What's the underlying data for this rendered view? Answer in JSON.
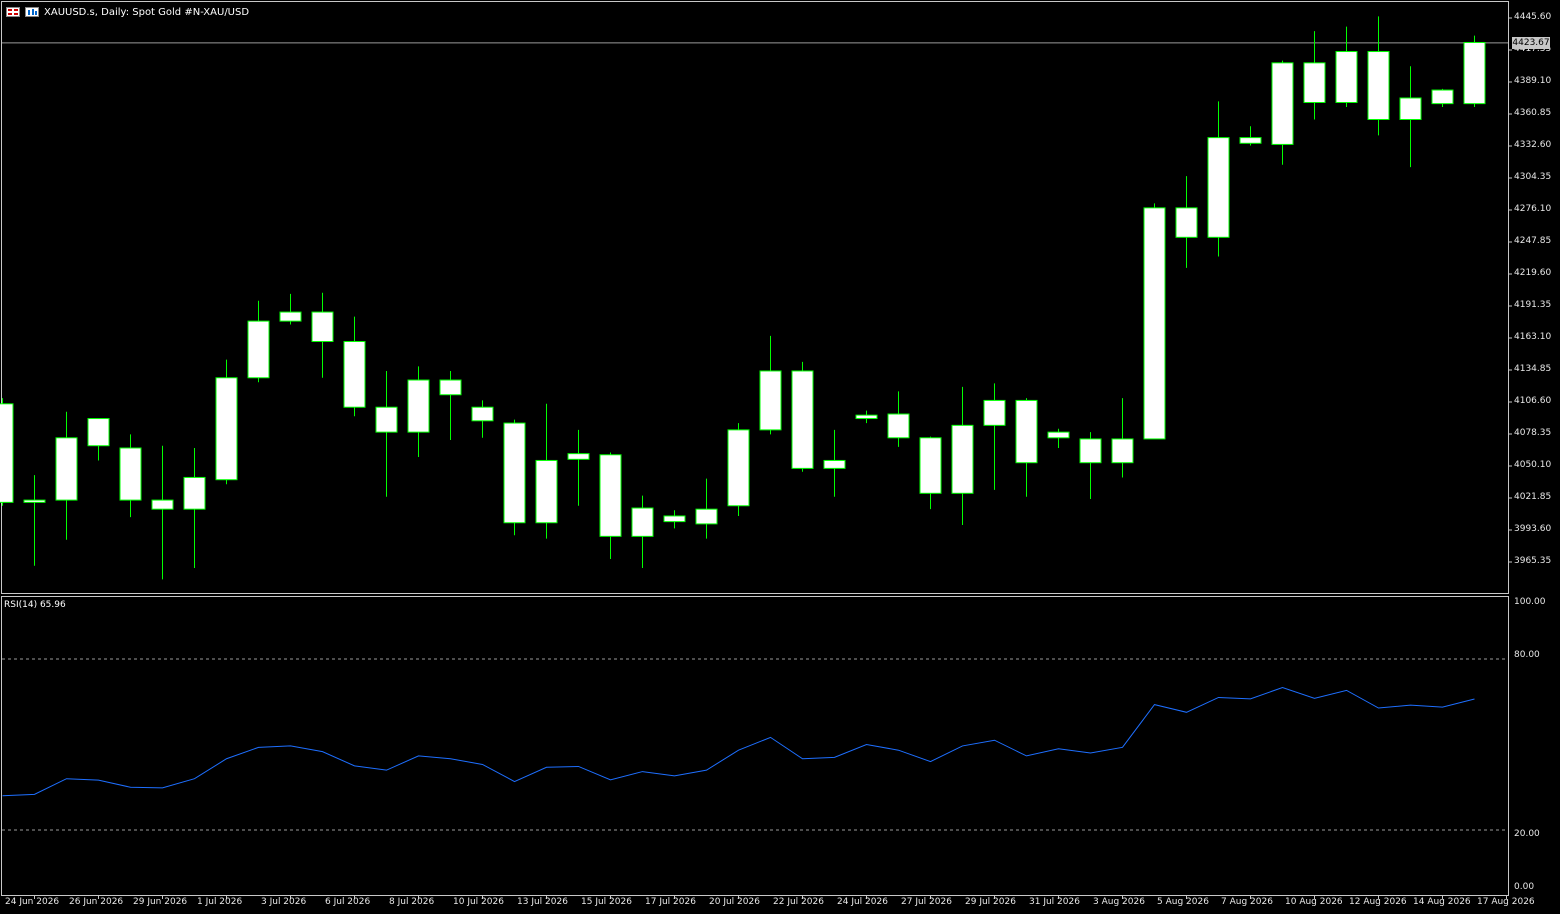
{
  "header": {
    "symbol": "XAUUSD.s",
    "timeframe": "Daily",
    "description": "Spot Gold #N-XAU/USD",
    "title_text": "XAUUSD.s, Daily:  Spot Gold #N-XAU/USD"
  },
  "rsi": {
    "label": "RSI(14) 65.96",
    "levels": [
      "100.00",
      "80.00",
      "20.00",
      "0.00"
    ],
    "upper": 80,
    "lower": 20
  },
  "price_axis_labels": [
    "4445.60",
    "4417.35",
    "4389.10",
    "4360.85",
    "4332.60",
    "4304.35",
    "4276.10",
    "4247.85",
    "4219.60",
    "4191.35",
    "4163.10",
    "4134.85",
    "4106.60",
    "4078.35",
    "4050.10",
    "4021.85",
    "3993.60",
    "3965.35"
  ],
  "current_price": "4423.67",
  "date_labels": [
    "24 Jun 2026",
    "26 Jun 2026",
    "29 Jun 2026",
    "1 Jul 2026",
    "3 Jul 2026",
    "6 Jul 2026",
    "8 Jul 2026",
    "10 Jul 2026",
    "13 Jul 2026",
    "15 Jul 2026",
    "17 Jul 2026",
    "20 Jul 2026",
    "22 Jul 2026",
    "24 Jul 2026",
    "27 Jul 2026",
    "29 Jul 2026",
    "31 Jul 2026",
    "3 Aug 2026",
    "5 Aug 2026",
    "7 Aug 2026",
    "10 Aug 2026",
    "12 Aug 2026",
    "14 Aug 2026",
    "17 Aug 2026"
  ],
  "colors": {
    "background": "#000000",
    "wick": "#00ff00",
    "bull_body": "#ffffff",
    "bear_body": "#ffffff",
    "rsi_line": "#1e6fff",
    "grid": "#c8c8c8"
  },
  "chart_data": [
    {
      "type": "candlestick",
      "title": "XAUUSD.s, Daily:  Spot Gold #N-XAU/USD",
      "ylim": [
        3950,
        4455
      ],
      "candles": [
        {
          "date": "23 Jun 2026",
          "open": 4105,
          "high": 4110,
          "low": 4015,
          "close": 4018
        },
        {
          "date": "24 Jun 2026",
          "open": 4018,
          "high": 4042,
          "low": 3962,
          "close": 4020
        },
        {
          "date": "25 Jun 2026",
          "open": 4020,
          "high": 4098,
          "low": 3985,
          "close": 4075
        },
        {
          "date": "26 Jun 2026",
          "open": 4092,
          "high": 4092,
          "low": 4055,
          "close": 4068
        },
        {
          "date": "29 Jun 2026",
          "open": 4066,
          "high": 4078,
          "low": 4005,
          "close": 4020
        },
        {
          "date": "30 Jun 2026",
          "open": 4020,
          "high": 4068,
          "low": 3950,
          "close": 4012
        },
        {
          "date": "1 Jul 2026",
          "open": 4012,
          "high": 4066,
          "low": 3960,
          "close": 4040
        },
        {
          "date": "2 Jul 2026",
          "open": 4038,
          "high": 4144,
          "low": 4034,
          "close": 4128
        },
        {
          "date": "3 Jul 2026",
          "open": 4128,
          "high": 4196,
          "low": 4124,
          "close": 4178
        },
        {
          "date": "4 Jul 2026",
          "open": 4178,
          "high": 4202,
          "low": 4175,
          "close": 4186
        },
        {
          "date": "6 Jul 2026",
          "open": 4186,
          "high": 4203,
          "low": 4128,
          "close": 4160
        },
        {
          "date": "7 Jul 2026",
          "open": 4160,
          "high": 4182,
          "low": 4094,
          "close": 4102
        },
        {
          "date": "8 Jul 2026",
          "open": 4102,
          "high": 4134,
          "low": 4023,
          "close": 4080
        },
        {
          "date": "9 Jul 2026",
          "open": 4080,
          "high": 4138,
          "low": 4058,
          "close": 4126
        },
        {
          "date": "10 Jul 2026",
          "open": 4126,
          "high": 4134,
          "low": 4073,
          "close": 4113
        },
        {
          "date": "11 Jul 2026",
          "open": 4102,
          "high": 4108,
          "low": 4075,
          "close": 4090
        },
        {
          "date": "13 Jul 2026",
          "open": 4088,
          "high": 4091,
          "low": 3989,
          "close": 4000
        },
        {
          "date": "14 Jul 2026",
          "open": 4000,
          "high": 4105,
          "low": 3986,
          "close": 4055
        },
        {
          "date": "15 Jul 2026",
          "open": 4056,
          "high": 4082,
          "low": 4015,
          "close": 4061
        },
        {
          "date": "16 Jul 2026",
          "open": 4060,
          "high": 4062,
          "low": 3968,
          "close": 3988
        },
        {
          "date": "17 Jul 2026",
          "open": 3988,
          "high": 4024,
          "low": 3960,
          "close": 4013
        },
        {
          "date": "18 Jul 2026",
          "open": 4001,
          "high": 4011,
          "low": 3995,
          "close": 4006
        },
        {
          "date": "20 Jul 2026",
          "open": 3999,
          "high": 4039,
          "low": 3986,
          "close": 4012
        },
        {
          "date": "21 Jul 2026",
          "open": 4015,
          "high": 4088,
          "low": 4006,
          "close": 4082
        },
        {
          "date": "22 Jul 2026",
          "open": 4082,
          "high": 4165,
          "low": 4078,
          "close": 4134
        },
        {
          "date": "23 Jul 2026",
          "open": 4134,
          "high": 4142,
          "low": 4045,
          "close": 4048
        },
        {
          "date": "24 Jul 2026",
          "open": 4048,
          "high": 4082,
          "low": 4023,
          "close": 4055
        },
        {
          "date": "25 Jul 2026",
          "open": 4095,
          "high": 4099,
          "low": 4088,
          "close": 4092
        },
        {
          "date": "27 Jul 2026",
          "open": 4096,
          "high": 4116,
          "low": 4067,
          "close": 4075
        },
        {
          "date": "28 Jul 2026",
          "open": 4075,
          "high": 4076,
          "low": 4012,
          "close": 4026
        },
        {
          "date": "29 Jul 2026",
          "open": 4026,
          "high": 4120,
          "low": 3998,
          "close": 4086
        },
        {
          "date": "30 Jul 2026",
          "open": 4086,
          "high": 4123,
          "low": 4029,
          "close": 4108
        },
        {
          "date": "31 Jul 2026",
          "open": 4108,
          "high": 4110,
          "low": 4023,
          "close": 4053
        },
        {
          "date": "1 Aug 2026",
          "open": 4075,
          "high": 4083,
          "low": 4066,
          "close": 4080
        },
        {
          "date": "3 Aug 2026",
          "open": 4074,
          "high": 4080,
          "low": 4021,
          "close": 4053
        },
        {
          "date": "4 Aug 2026",
          "open": 4053,
          "high": 4110,
          "low": 4040,
          "close": 4074
        },
        {
          "date": "5 Aug 2026",
          "open": 4074,
          "high": 4282,
          "low": 4074,
          "close": 4278
        },
        {
          "date": "6 Aug 2026",
          "open": 4278,
          "high": 4306,
          "low": 4225,
          "close": 4252
        },
        {
          "date": "7 Aug 2026",
          "open": 4252,
          "high": 4372,
          "low": 4235,
          "close": 4340
        },
        {
          "date": "8 Aug 2026",
          "open": 4335,
          "high": 4350,
          "low": 4333,
          "close": 4340
        },
        {
          "date": "10 Aug 2026",
          "open": 4334,
          "high": 4408,
          "low": 4316,
          "close": 4406
        },
        {
          "date": "11 Aug 2026",
          "open": 4406,
          "high": 4434,
          "low": 4356,
          "close": 4371
        },
        {
          "date": "12 Aug 2026",
          "open": 4371,
          "high": 4438,
          "low": 4367,
          "close": 4416
        },
        {
          "date": "13 Aug 2026",
          "open": 4416,
          "high": 4447,
          "low": 4342,
          "close": 4356
        },
        {
          "date": "14 Aug 2026",
          "open": 4356,
          "high": 4403,
          "low": 4314,
          "close": 4375
        },
        {
          "date": "15 Aug 2026",
          "open": 4370,
          "high": 4383,
          "low": 4367,
          "close": 4382
        },
        {
          "date": "17 Aug 2026",
          "open": 4370,
          "high": 4430,
          "low": 4367,
          "close": 4424
        }
      ]
    },
    {
      "type": "line",
      "title": "RSI(14) 65.96",
      "ylim": [
        0,
        100
      ],
      "series": [
        {
          "values": [
            32,
            32.5,
            38,
            37.5,
            35,
            34.8,
            38,
            45,
            49,
            49.5,
            47.5,
            42.5,
            41,
            46,
            45,
            43,
            37,
            42,
            42.3,
            37.6,
            40.5,
            39,
            41,
            48,
            52.5,
            45,
            45.5,
            50,
            48,
            44,
            49.5,
            51.5,
            46,
            48.5,
            47,
            49,
            64,
            61.3,
            66.5,
            66,
            70,
            66.2,
            69,
            62.8,
            63.8,
            63.1,
            65.96
          ]
        }
      ]
    }
  ]
}
